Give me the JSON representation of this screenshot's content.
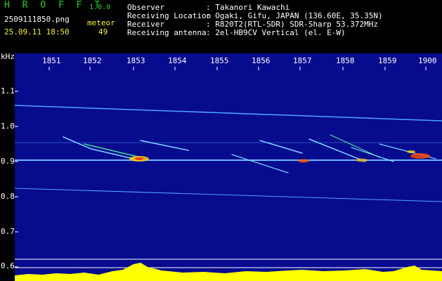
{
  "app": {
    "name": "H R O F F T",
    "version": "1.0.0"
  },
  "file": {
    "name": "2509111850.png",
    "datetime": "25.09.11 18:50"
  },
  "counter": {
    "label": "meteor",
    "count": "49"
  },
  "meta": [
    {
      "key": "Observer",
      "value": ": Takanori Kawachi"
    },
    {
      "key": "Receiving Location",
      "value": ": Ogaki, Gifu, JAPAN (136.60E, 35.35N)"
    },
    {
      "key": "Receiver",
      "value": ": R820T2(RTL-SDR) SDR-Sharp 53.372MHz"
    },
    {
      "key": "Receiving antenna",
      "value": ": 2el-HB9CV Vertical (el. E-W)"
    }
  ],
  "axis": {
    "y_unit": "kHz",
    "y_ticks": [
      "1.1",
      "1.0",
      "0.9",
      "0.8",
      "0.7",
      "0.6"
    ],
    "x_ticks": [
      "1851",
      "1852",
      "1853",
      "1854",
      "1855",
      "1856",
      "1857",
      "1858",
      "1859",
      "1900"
    ]
  },
  "colors": {
    "background": "#070b8e",
    "signal": "#ffff00",
    "baseline": "#00ffff",
    "trace": "#4fa3ff"
  }
}
